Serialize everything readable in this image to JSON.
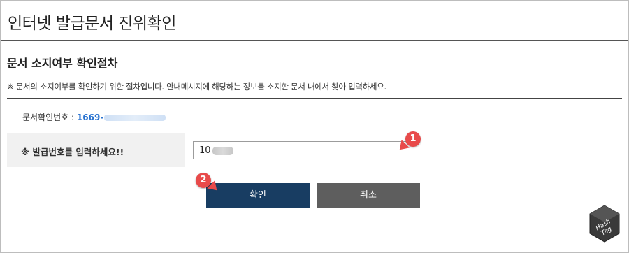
{
  "header": {
    "title": "인터넷 발급문서 진위확인"
  },
  "section": {
    "title": "문서 소지여부 확인절차",
    "notice": "※ 문서의 소지여부를 확인하기 위한 절차입니다. 안내메시지에 해당하는 정보를 소지한 문서 내에서 찾아 입력하세요."
  },
  "document": {
    "label": "문서확인번호 :",
    "number_visible": "1669-"
  },
  "issue_number": {
    "label": "※ 발급번호를 입력하세요!!",
    "value_visible": "10"
  },
  "buttons": {
    "confirm": "확인",
    "cancel": "취소"
  },
  "annotations": {
    "marker_1": "1",
    "marker_2": "2"
  },
  "logo": {
    "line1": "Hash",
    "line2": "Tag"
  },
  "colors": {
    "confirm_button": "#183d62",
    "cancel_button": "#5e5e5e",
    "link_blue": "#2a73d0",
    "marker_red": "#e84a4a"
  }
}
